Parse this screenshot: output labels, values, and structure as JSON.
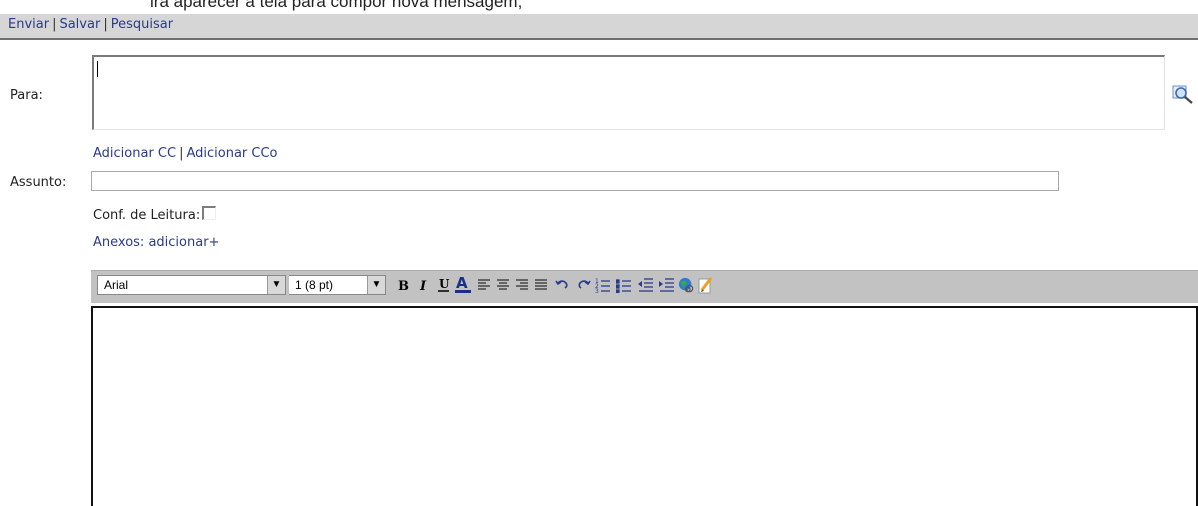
{
  "cutoff_caption": "irá aparecer a tela para compor nova mensagem;",
  "top_actions": {
    "send": "Enviar",
    "save": "Salvar",
    "search": "Pesquisar",
    "separator": "|"
  },
  "form": {
    "to_label": "Para:",
    "add_cc": "Adicionar CC",
    "add_bcc": "Adicionar CCo",
    "subject_label": "Assunto:",
    "read_receipt_label": "Conf. de Leitura:",
    "attachments_prefix": "Anexos:",
    "attachments_add": "adicionar+"
  },
  "editor_toolbar": {
    "font_value": "Arial",
    "size_value": "1 (8 pt)",
    "buttons": [
      "bold-icon",
      "italic-icon",
      "underline-icon",
      "font-color-icon",
      "align-left-icon",
      "align-center-icon",
      "align-right-icon",
      "align-justify-icon",
      "undo-icon",
      "redo-icon",
      "numbered-list-icon",
      "bullet-list-icon",
      "outdent-icon",
      "indent-icon",
      "insert-link-icon",
      "spell-check-icon"
    ]
  },
  "colors": {
    "link": "#2a3a8c",
    "toolbar_bg": "#c2c2c2",
    "topbar_bg": "#d6d6d6"
  }
}
